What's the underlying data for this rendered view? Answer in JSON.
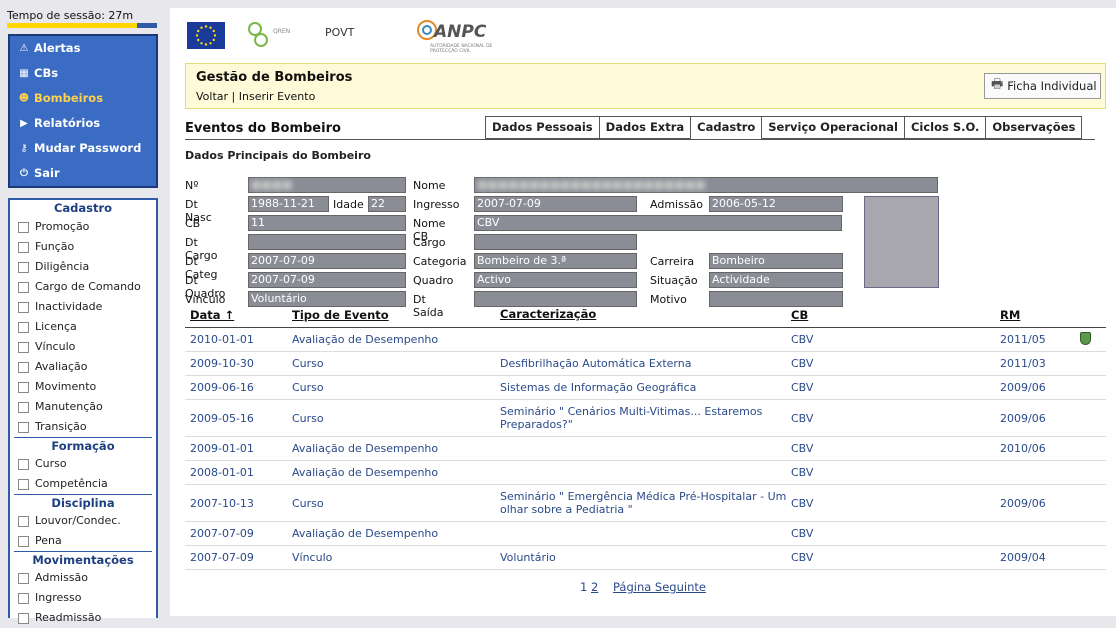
{
  "session": {
    "text": "Tempo de sessão: 27m"
  },
  "menu": [
    {
      "label": "Alertas",
      "icon": "warning-icon",
      "glyph": "⚠",
      "active": false
    },
    {
      "label": "CBs",
      "icon": "fire-station-icon",
      "glyph": "▦",
      "active": false
    },
    {
      "label": "Bombeiros",
      "icon": "firefighters-icon",
      "glyph": "☻",
      "active": true
    },
    {
      "label": "Relatórios",
      "icon": "play-arrow-icon",
      "glyph": "▶",
      "active": false
    },
    {
      "label": "Mudar Password",
      "icon": "keys-icon",
      "glyph": "⚷",
      "active": false
    },
    {
      "label": "Sair",
      "icon": "power-icon",
      "glyph": "⏻",
      "active": false
    }
  ],
  "filters": [
    {
      "section": "Cadastro",
      "items": [
        "Promoção",
        "Função",
        "Diligência",
        "Cargo de Comando",
        "Inactividade",
        "Licença",
        "Vínculo",
        "Avaliação",
        "Movimento",
        "Manutenção",
        "Transição"
      ]
    },
    {
      "section": "Formação",
      "items": [
        "Curso",
        "Competência"
      ]
    },
    {
      "section": "Disciplina",
      "items": [
        "Louvor/Condec.",
        "Pena"
      ]
    },
    {
      "section": "Movimentações",
      "items": [
        "Admissão",
        "Ingresso",
        "Readmissão"
      ]
    }
  ],
  "logos": {
    "povt": "POVT",
    "anpc": "ANPC",
    "anpc_sub": "AUTORIDADE NACIONAL DE PROTECÇÃO CIVIL",
    "qren": "QREN"
  },
  "header": {
    "title": "Gestão de Bombeiros",
    "link_back": "Voltar",
    "separator": "|",
    "link_insert": "Inserir Evento",
    "ficha_label": "Ficha Individual"
  },
  "section": {
    "title": "Eventos do Bombeiro",
    "subtitle": "Dados Principais do Bombeiro"
  },
  "tabs": [
    "Dados Pessoais",
    "Dados Extra",
    "Cadastro",
    "Serviço Operacional",
    "Ciclos S.O.",
    "Observações"
  ],
  "active_tab": "Cadastro",
  "form": {
    "labels": {
      "no": "Nº",
      "nome": "Nome",
      "dt_nasc": "Dt Nasc",
      "idade": "Idade",
      "ingresso": "Ingresso",
      "admissao": "Admissão",
      "cb": "CB",
      "nome_cb": "Nome CB",
      "dt_cargo": "Dt Cargo",
      "cargo": "Cargo",
      "dt_categ": "Dt Categ",
      "categoria": "Categoria",
      "carreira": "Carreira",
      "dt_quadro": "Dt Quadro",
      "quadro": "Quadro",
      "situacao": "Situação",
      "vinculo": "Vínculo",
      "dt_saida": "Dt Saída",
      "motivo": "Motivo"
    },
    "values": {
      "dt_nasc": "1988-11-21",
      "idade": "22",
      "ingresso": "2007-07-09",
      "admissao": "2006-05-12",
      "cb": "11",
      "nome_cb": "CBV",
      "dt_categ": "2007-07-09",
      "categoria": "Bombeiro de 3.ª",
      "carreira": "Bombeiro",
      "dt_quadro": "2007-07-09",
      "quadro": "Activo",
      "situacao": "Actividade",
      "vinculo": "Voluntário"
    }
  },
  "table": {
    "headers": [
      "Data ↑",
      "Tipo de Evento",
      "Caracterização",
      "CB",
      "RM"
    ],
    "rows": [
      {
        "data": "2010-01-01",
        "tipo": "Avaliação de Desempenho",
        "carac": "",
        "cb": "CBV",
        "rm": "2011/05",
        "icon": true
      },
      {
        "data": "2009-10-30",
        "tipo": "Curso",
        "carac": "Desfibrilhação Automática Externa",
        "cb": "CBV",
        "rm": "2011/03",
        "icon": false
      },
      {
        "data": "2009-06-16",
        "tipo": "Curso",
        "carac": "Sistemas de Informação Geográfica",
        "cb": "CBV",
        "rm": "2009/06",
        "icon": false
      },
      {
        "data": "2009-05-16",
        "tipo": "Curso",
        "carac": "Seminário \" Cenários Multi-Vitimas... Estaremos Preparados?\"",
        "cb": "CBV",
        "rm": "2009/06",
        "icon": false
      },
      {
        "data": "2009-01-01",
        "tipo": "Avaliação de Desempenho",
        "carac": "",
        "cb": "CBV",
        "rm": "2010/06",
        "icon": false
      },
      {
        "data": "2008-01-01",
        "tipo": "Avaliação de Desempenho",
        "carac": "",
        "cb": "CBV",
        "rm": "",
        "icon": false
      },
      {
        "data": "2007-10-13",
        "tipo": "Curso",
        "carac": "Seminário \" Emergência Médica Pré-Hospitalar - Um olhar sobre a Pediatria \"",
        "cb": "CBV",
        "rm": "2009/06",
        "icon": false
      },
      {
        "data": "2007-07-09",
        "tipo": "Avaliação de Desempenho",
        "carac": "",
        "cb": "CBV",
        "rm": "",
        "icon": false
      },
      {
        "data": "2007-07-09",
        "tipo": "Vínculo",
        "carac": "Voluntário",
        "cb": "CBV",
        "rm": "2009/04",
        "icon": false
      }
    ]
  },
  "pager": {
    "page1": "1",
    "page2": "2",
    "next": "Página Seguinte"
  }
}
